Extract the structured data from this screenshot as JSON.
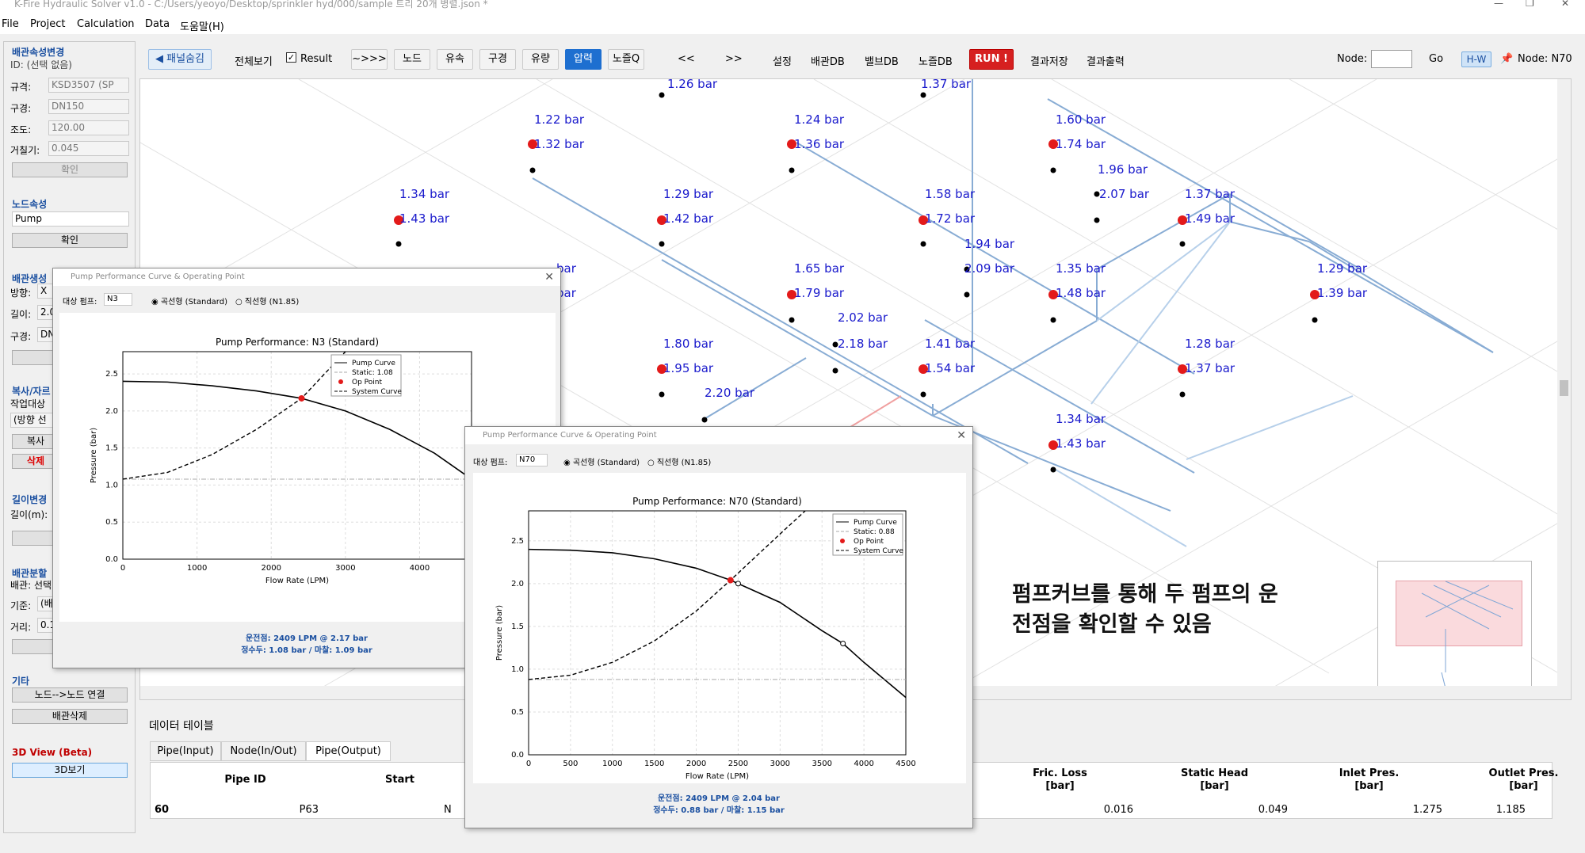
{
  "window": {
    "title": "K-Fire Hydraulic Solver v1.0 - C:/Users/yeoyo/Desktop/sprinkler hyd/000/sample 트리 20개 병렬.json *"
  },
  "menu": [
    "File",
    "Project",
    "Calculation",
    "Data",
    "도움말(H)"
  ],
  "left": {
    "pipe_props_title": "배관속성변경",
    "pipe_id": "ID: (선택 없음)",
    "std_label": "규격:",
    "std_value": "KSD3507 (SP",
    "size_label": "구경:",
    "size_value": "DN150",
    "rough_label": "조도:",
    "rough_value": "120.00",
    "roughness_label": "거칠기:",
    "roughness_value": "0.045",
    "confirm1": "확인",
    "node_props_title": "노드속성",
    "node_type": "Pump",
    "confirm2": "확인",
    "pipe_gen_title": "배관생성",
    "dir_label": "방향:",
    "dir_value": "X",
    "len_label": "길이:",
    "len_value": "2.0",
    "gen_size_label": "구경:",
    "gen_size_value": "DN",
    "copy_title": "복사/자르",
    "work_target": "작업대상",
    "dir_select": "(방향 선",
    "copy_btn": "복사",
    "delete_btn": "삭제",
    "len_change_title": "길이변경",
    "len_m": "길이(m):",
    "split_title": "배관분할",
    "split_sel": "배관: 선택",
    "base_label": "기준:",
    "base_value": "(배",
    "dist_label": "거리:",
    "dist_value": "0.1",
    "etc_title": "기타",
    "node_link_btn": "노드-->노드 연결",
    "pipe_del_btn": "배관삭제",
    "view3d_title": "3D View (Beta)",
    "view3d_btn": "3D보기"
  },
  "toolbar": {
    "hide_panel": "◀ 패널숨김",
    "view_all": "전체보기",
    "result": "Result",
    "items": [
      "~>>>",
      "노드",
      "유속",
      "구경",
      "유량",
      "압력",
      "노즐Q"
    ],
    "active": "압력",
    "prev": "<<",
    "next": ">>",
    "settings": "설정",
    "pipe_db": "배관DB",
    "valve_db": "밸브DB",
    "nozzle_db": "노즐DB",
    "run": "RUN !",
    "save_result": "결과저장",
    "export_result": "결과출력",
    "node_label": "Node:",
    "go": "Go",
    "hw": "H-W",
    "node_current": "Node: N70"
  },
  "canvas": {
    "labels": [
      "1.26 bar",
      "1.37 bar",
      "1.22 bar",
      "1.24 bar",
      "1.60 bar",
      "1.32 bar",
      "1.36 bar",
      "1.74 bar",
      "1.96 bar",
      "1.34 bar",
      "1.29 bar",
      "1.58 bar",
      "2.07 bar",
      "1.37 bar",
      "1.43 bar",
      "1.42 bar",
      "1.72 bar",
      "1.49 bar",
      "1.94 bar",
      "1.65 bar",
      "2.09 bar",
      "1.35 bar",
      "1.29 bar",
      "1.79 bar",
      "1.48 bar",
      "1.39 bar",
      "2.02 bar",
      "1.80 bar",
      "2.18 bar",
      "1.41 bar",
      "1.28 bar",
      "1.95 bar",
      "1.54 bar",
      "1.37 bar",
      "2.20 bar",
      "1.34 bar",
      "1.43 bar",
      "bar",
      "bar"
    ],
    "note_line1": "펌프커브를 통해 두 펌프의 운",
    "note_line2": "전점을 확인할 수 있음"
  },
  "dialog1": {
    "title": "Pump Performance Curve & Operating Point",
    "target_label": "대상 펌프:",
    "target_value": "N3",
    "radio1": "곡선형 (Standard)",
    "radio2": "직선형 (N1.85)",
    "plot_title": "Pump Performance: N3 (Standard)",
    "xlabel": "Flow Rate (LPM)",
    "ylabel": "Pressure (bar)",
    "legend": [
      "Pump Curve",
      "Static: 1.08",
      "Op Point",
      "System Curve"
    ],
    "info1": "운전점: 2409 LPM @ 2.17 bar",
    "info2": "정수두: 1.08 bar / 마찰: 1.09 bar"
  },
  "dialog2": {
    "title": "Pump Performance Curve & Operating Point",
    "target_label": "대상 펌프:",
    "target_value": "N70",
    "radio1": "곡선형 (Standard)",
    "radio2": "직선형 (N1.85)",
    "plot_title": "Pump Performance: N70 (Standard)",
    "xlabel": "Flow Rate (LPM)",
    "ylabel": "Pressure (bar)",
    "legend": [
      "Pump Curve",
      "Static: 0.88",
      "Op Point",
      "System Curve"
    ],
    "info1": "운전점: 2409 LPM @ 2.04 bar",
    "info2": "정수두: 0.88 bar / 마찰: 1.15 bar"
  },
  "table": {
    "title": "데이터 테이블",
    "tabs": [
      "Pipe(Input)",
      "Node(In/Out)",
      "Pipe(Output)"
    ],
    "active_tab": "Pipe(Output)",
    "columns": [
      "Pipe ID",
      "Start",
      "Fric. Loss\n[bar]",
      "Static Head\n[bar]",
      "Inlet Pres.\n[bar]",
      "Outlet Pres.\n[bar]"
    ],
    "row": {
      "index": "60",
      "pipe_id": "P63",
      "start": "N",
      "fric": "0.016",
      "static": "0.049",
      "inlet": "1.275",
      "outlet": "1.185"
    }
  },
  "chart_data": [
    {
      "type": "line",
      "title": "Pump Performance: N3 (Standard)",
      "xlabel": "Flow Rate (LPM)",
      "ylabel": "Pressure (bar)",
      "xlim": [
        0,
        4700
      ],
      "ylim": [
        0,
        2.8
      ],
      "series": [
        {
          "name": "Pump Curve",
          "x": [
            0,
            600,
            1200,
            1800,
            2409,
            3000,
            3600,
            4200,
            4700
          ],
          "y": [
            2.4,
            2.39,
            2.34,
            2.27,
            2.17,
            2.0,
            1.75,
            1.43,
            1.08
          ]
        },
        {
          "name": "Static: 1.08",
          "x": [
            0,
            4700
          ],
          "y": [
            1.08,
            1.08
          ]
        },
        {
          "name": "System Curve",
          "x": [
            0,
            600,
            1200,
            1800,
            2409,
            3000
          ],
          "y": [
            1.08,
            1.17,
            1.41,
            1.75,
            2.17,
            2.8
          ]
        },
        {
          "name": "Op Point",
          "x": [
            2409
          ],
          "y": [
            2.17
          ]
        }
      ]
    },
    {
      "type": "line",
      "title": "Pump Performance: N70 (Standard)",
      "xlabel": "Flow Rate (LPM)",
      "ylabel": "Pressure (bar)",
      "xlim": [
        0,
        4500
      ],
      "ylim": [
        0,
        2.85
      ],
      "series": [
        {
          "name": "Pump Curve",
          "x": [
            0,
            500,
            1000,
            1500,
            2000,
            2409,
            2500,
            3000,
            3500,
            3750,
            4000,
            4500
          ],
          "y": [
            2.4,
            2.39,
            2.36,
            2.29,
            2.18,
            2.04,
            2.0,
            1.78,
            1.45,
            1.3,
            1.08,
            0.67
          ],
          "markers": [
            [
              2500,
              2.0
            ],
            [
              3750,
              1.3
            ]
          ]
        },
        {
          "name": "Static: 0.88",
          "x": [
            0,
            4500
          ],
          "y": [
            0.88,
            0.88
          ]
        },
        {
          "name": "System Curve",
          "x": [
            0,
            500,
            1000,
            1500,
            2000,
            2409,
            3000,
            3300
          ],
          "y": [
            0.88,
            0.93,
            1.08,
            1.33,
            1.68,
            2.04,
            2.58,
            2.85
          ]
        },
        {
          "name": "Op Point",
          "x": [
            2409
          ],
          "y": [
            2.04
          ]
        }
      ]
    }
  ]
}
